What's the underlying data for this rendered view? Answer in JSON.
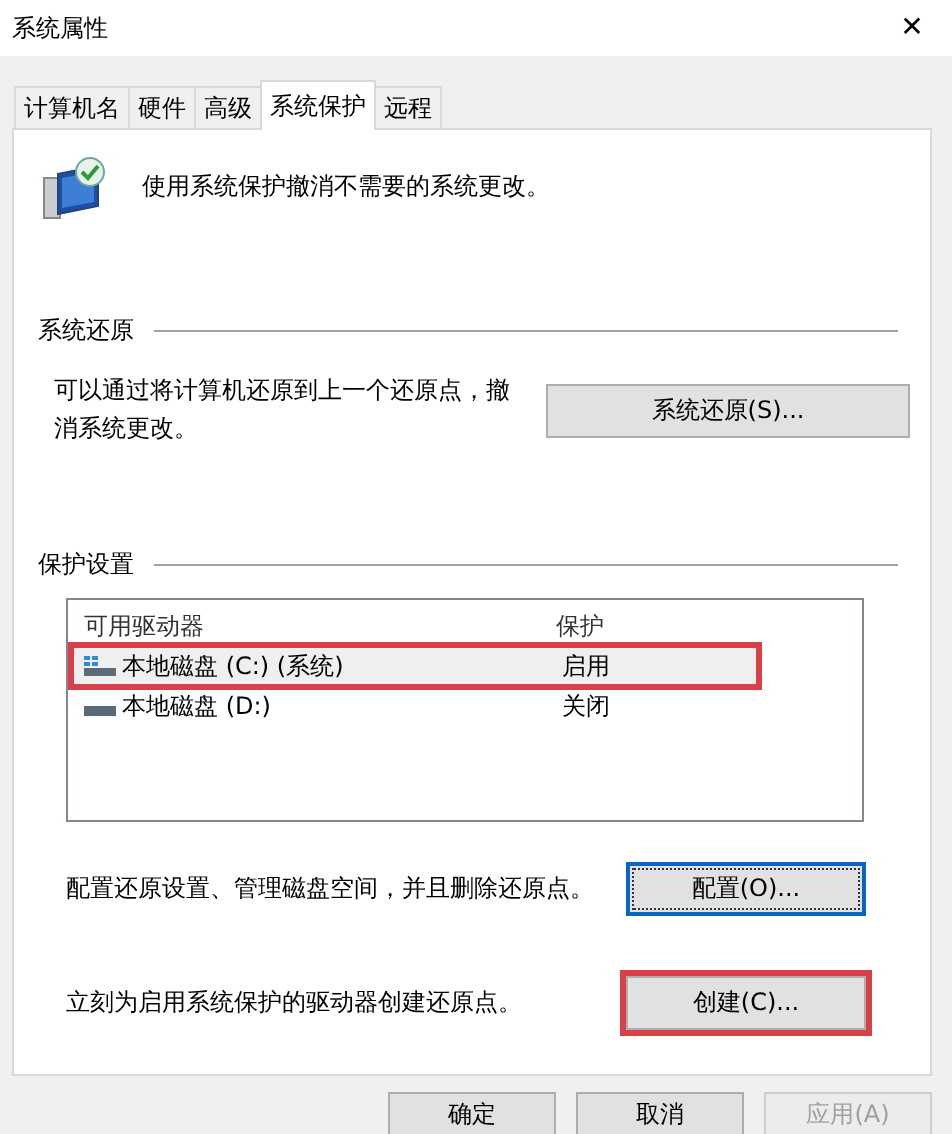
{
  "window": {
    "title": "系统属性",
    "close": "✕"
  },
  "tabs": [
    {
      "label": "计算机名",
      "selected": false
    },
    {
      "label": "硬件",
      "selected": false
    },
    {
      "label": "高级",
      "selected": false
    },
    {
      "label": "系统保护",
      "selected": true
    },
    {
      "label": "远程",
      "selected": false
    }
  ],
  "intro": "使用系统保护撤消不需要的系统更改。",
  "restore": {
    "heading": "系统还原",
    "text": "可以通过将计算机还原到上一个还原点，撤消系统更改。",
    "button": {
      "label": "系统还原(S)...",
      "focused": false,
      "highlighted": false
    }
  },
  "protection": {
    "heading": "保护设置",
    "columns": [
      "可用驱动器",
      "保护"
    ],
    "drives": [
      {
        "name": "本地磁盘 (C:) (系统)",
        "status": "启用",
        "kind": "system",
        "selected": true,
        "highlighted": true
      },
      {
        "name": "本地磁盘 (D:)",
        "status": "关闭",
        "kind": "plain",
        "selected": false,
        "highlighted": false
      }
    ],
    "configure": {
      "text": "配置还原设置、管理磁盘空间，并且删除还原点。",
      "button": {
        "label": "配置(O)...",
        "focused": true,
        "highlighted": false
      }
    },
    "create": {
      "text": "立刻为启用系统保护的驱动器创建还原点。",
      "button": {
        "label": "创建(C)...",
        "focused": false,
        "highlighted": true
      }
    }
  },
  "buttons": [
    {
      "label": "确定",
      "disabled": false
    },
    {
      "label": "取消",
      "disabled": false
    },
    {
      "label": "应用(A)",
      "disabled": true
    }
  ]
}
